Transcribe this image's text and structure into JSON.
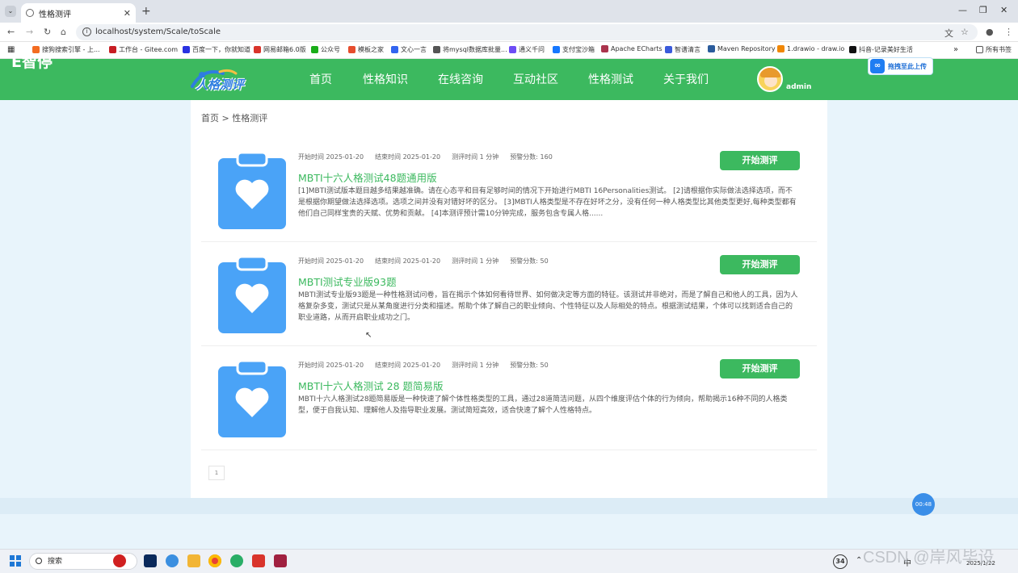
{
  "browser": {
    "tab_title": "性格测评",
    "url": "localhost/system/Scale/toScale",
    "bookmarks": [
      {
        "label": "搜狗搜索引擎 - 上...",
        "color": "#f36c21"
      },
      {
        "label": "工作台 - Gitee.com",
        "color": "#c71d23"
      },
      {
        "label": "百度一下，你就知道",
        "color": "#2932e1"
      },
      {
        "label": "网易邮箱6.0版",
        "color": "#d9342b"
      },
      {
        "label": "公众号",
        "color": "#1aad19"
      },
      {
        "label": "模板之家",
        "color": "#e64d2e"
      },
      {
        "label": "文心一言",
        "color": "#3264f0"
      },
      {
        "label": "将mysql数据库批量...",
        "color": "#555555"
      },
      {
        "label": "通义千问",
        "color": "#6d4cf5"
      },
      {
        "label": "支付宝沙箱",
        "color": "#1677ff"
      },
      {
        "label": "Apache ECharts",
        "color": "#aa344d"
      },
      {
        "label": "智谱清言",
        "color": "#3b5bdb"
      },
      {
        "label": "Maven Repository",
        "color": "#2b5c9c"
      },
      {
        "label": "1.drawio - draw.io",
        "color": "#f08705"
      },
      {
        "label": "抖音-记录美好生活",
        "color": "#111111"
      }
    ],
    "all_bookmarks": "所有书签"
  },
  "header": {
    "brand": "E智停",
    "logo_text": "人格测评",
    "nav": [
      "首页",
      "性格知识",
      "在线咨询",
      "互动社区",
      "性格测试",
      "关于我们"
    ],
    "username": "admin",
    "upload_label": "拖拽至此上传",
    "colors": {
      "primary": "#3cb95f",
      "clipboard": "#4aa3f7"
    }
  },
  "breadcrumb": {
    "home": "首页",
    "separator": ">",
    "current": "性格测评"
  },
  "tests": [
    {
      "start_label": "开始时间",
      "start": "2025-01-20",
      "end_label": "结束时间",
      "end": "2025-01-20",
      "duration_label": "测评时间",
      "duration": "1 分钟",
      "score_label": "预警分数:",
      "score": "160",
      "title": "MBTI十六人格测试48题通用版",
      "description": "[1]MBTI测试版本题目越多结果越准确。请在心态平和目有足够时间的情况下开始进行MBTI 16Personalities测试。 [2]请根据你实际做法选择选项，而不是根据你期望做法选择选项。选项之间并没有对错好坏的区分。 [3]MBTI人格类型是不存在好坏之分，没有任何一种人格类型比其他类型更好,每种类型都有他们自己同样宝贵的天赋、优势和贡献。 [4]本测评预计需10分钟完成，服务包含专属人格......",
      "button": "开始测评"
    },
    {
      "start_label": "开始时间",
      "start": "2025-01-20",
      "end_label": "结束时间",
      "end": "2025-01-20",
      "duration_label": "测评时间",
      "duration": "1 分钟",
      "score_label": "预警分数:",
      "score": "50",
      "title": "MBTI测试专业版93题",
      "description": "MBTI测试专业版93题是一种性格测试问卷，旨在揭示个体如何看待世界、如何做决定等方面的特征。该测试并非绝对，而是了解自己和他人的工具，因为人格复杂多变，测试只是从某角度进行分类和描述。帮助个体了解自己的职业倾向、个性特征以及人际相处的特点。根据测试结果，个体可以找到适合自己的职业道路，从而开启职业成功之门。",
      "button": "开始测评"
    },
    {
      "start_label": "开始时间",
      "start": "2025-01-20",
      "end_label": "结束时间",
      "end": "2025-01-20",
      "duration_label": "测评时间",
      "duration": "1 分钟",
      "score_label": "预警分数:",
      "score": "50",
      "title": "MBTI十六人格测试 28 题简易版",
      "description": "MBTI十六人格测试28题简易版是一种快速了解个体性格类型的工具，通过28道简洁问题，从四个维度评估个体的行为倾向，帮助揭示16种不同的人格类型，便于自我认知、理解他人及指导职业发展。测试简短高效，适合快速了解个人性格特点。",
      "button": "开始测评"
    }
  ],
  "pagination": {
    "current": "1"
  },
  "timer": "00:48",
  "taskbar": {
    "search_placeholder": "搜索",
    "badge": "34",
    "date": "2025/1/22",
    "lang": "中"
  },
  "watermark": "CSDN @岸风毕设"
}
